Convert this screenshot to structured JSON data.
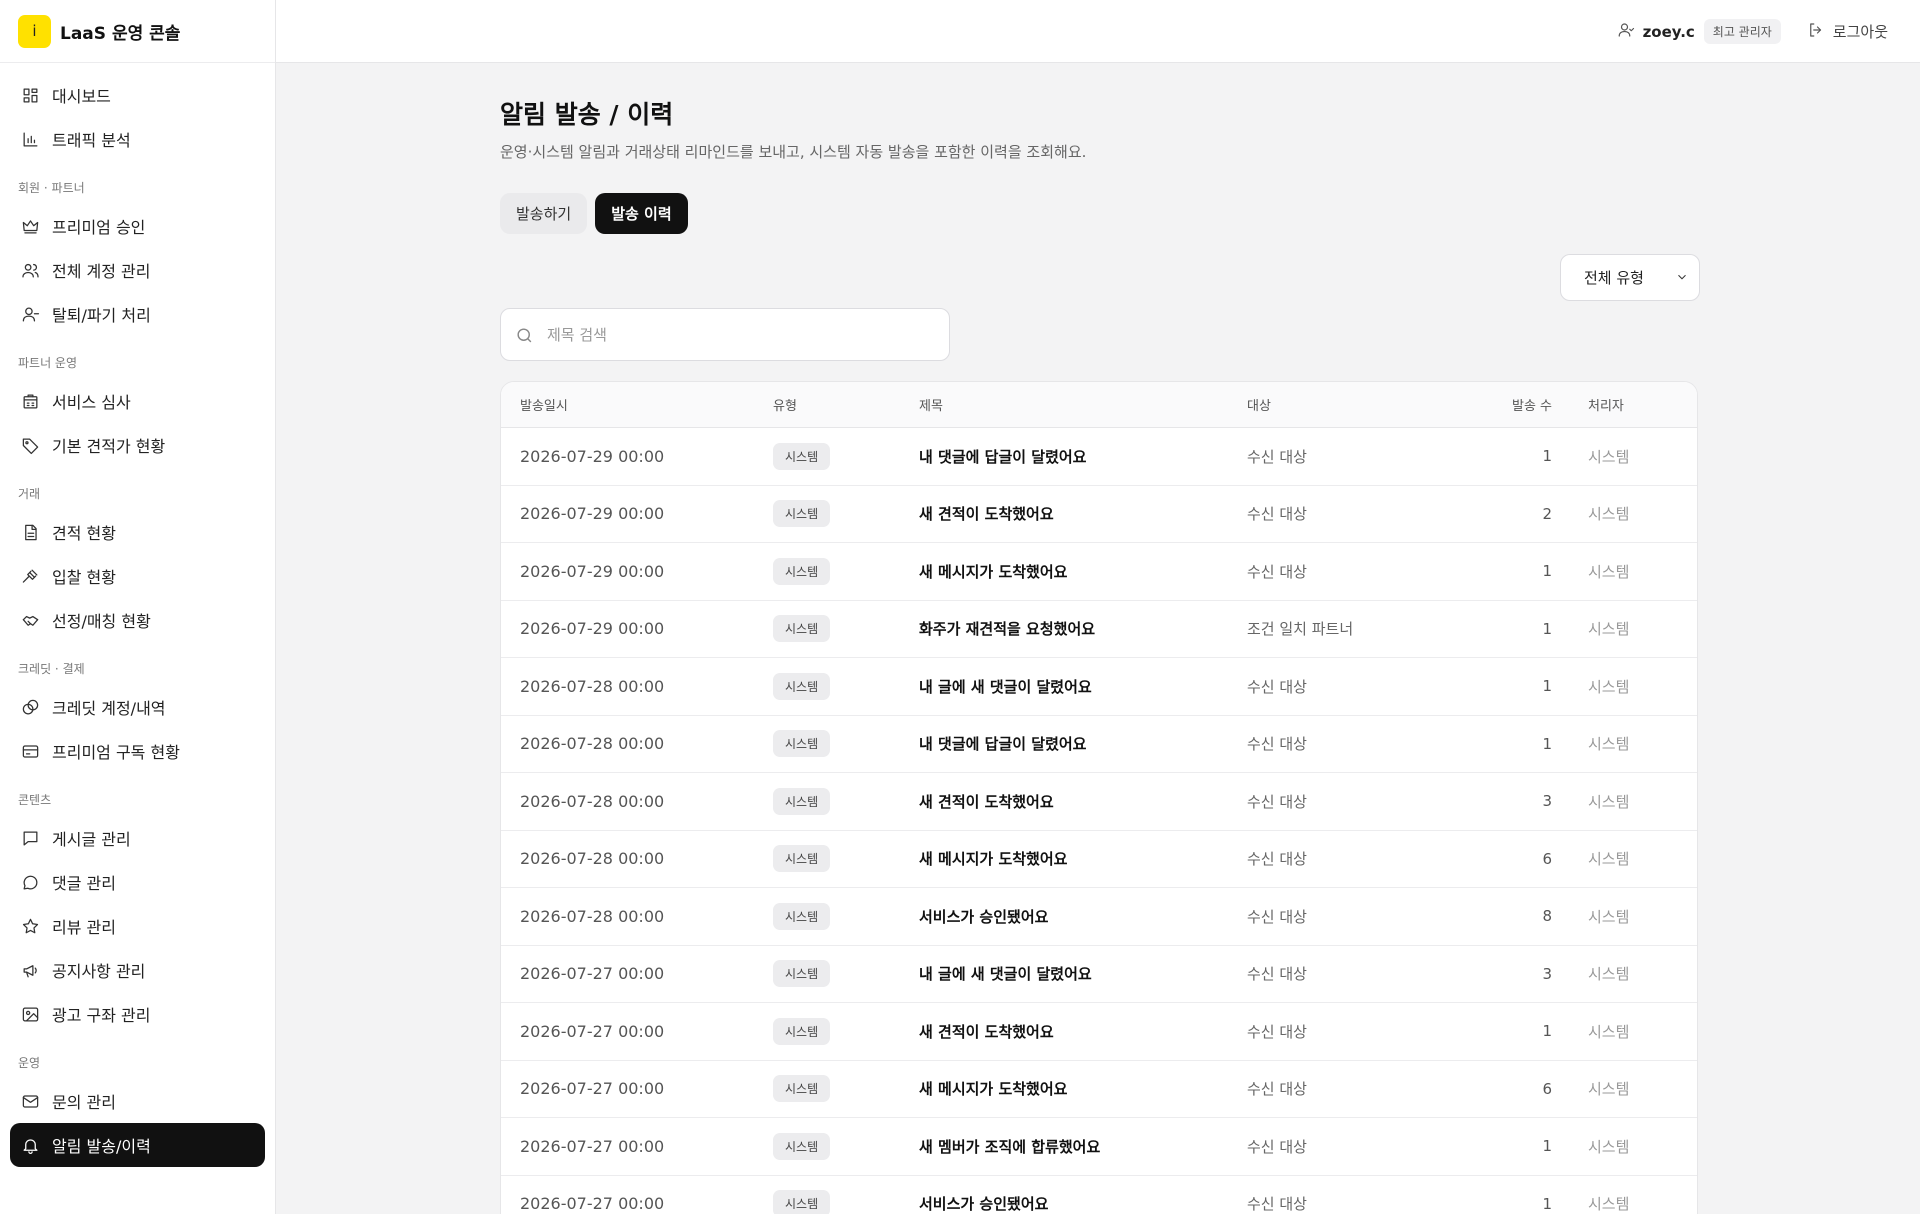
{
  "brand": {
    "logo_char": "i",
    "title": "LaaS 운영 콘솔",
    "accent": "#ffe100"
  },
  "header": {
    "user_name": "zoey.c",
    "role": "최고 관리자",
    "logout_label": "로그아웃"
  },
  "sidebar": {
    "top_items": [
      {
        "label": "대시보드",
        "icon": "dashboard-icon"
      },
      {
        "label": "트래픽 분석",
        "icon": "bar-chart-icon"
      }
    ],
    "groups": [
      {
        "title": "회원 · 파트너",
        "items": [
          {
            "label": "프리미엄 승인",
            "icon": "crown-icon"
          },
          {
            "label": "전체 계정 관리",
            "icon": "users-icon"
          },
          {
            "label": "탈퇴/파기 처리",
            "icon": "user-minus-icon"
          }
        ]
      },
      {
        "title": "파트너 운영",
        "items": [
          {
            "label": "서비스 심사",
            "icon": "building-icon"
          },
          {
            "label": "기본 견적가 현황",
            "icon": "tag-icon"
          }
        ]
      },
      {
        "title": "거래",
        "items": [
          {
            "label": "견적 현황",
            "icon": "document-icon"
          },
          {
            "label": "입찰 현황",
            "icon": "gavel-icon"
          },
          {
            "label": "선정/매칭 현황",
            "icon": "handshake-icon"
          }
        ]
      },
      {
        "title": "크레딧 · 결제",
        "items": [
          {
            "label": "크레딧 계정/내역",
            "icon": "coins-icon"
          },
          {
            "label": "프리미엄 구독 현황",
            "icon": "credit-card-icon"
          }
        ]
      },
      {
        "title": "콘텐츠",
        "items": [
          {
            "label": "게시글 관리",
            "icon": "message-square-icon"
          },
          {
            "label": "댓글 관리",
            "icon": "message-circle-icon"
          },
          {
            "label": "리뷰 관리",
            "icon": "star-icon"
          },
          {
            "label": "공지사항 관리",
            "icon": "megaphone-icon"
          },
          {
            "label": "광고 구좌 관리",
            "icon": "image-icon"
          }
        ]
      },
      {
        "title": "운영",
        "items": [
          {
            "label": "문의 관리",
            "icon": "mail-icon"
          },
          {
            "label": "알림 발송/이력",
            "icon": "bell-icon",
            "active": true
          }
        ]
      }
    ]
  },
  "page": {
    "title": "알림 발송 / 이력",
    "description": "운영·시스템 알림과 거래상태 리마인드를 보내고, 시스템 자동 발송을 포함한 이력을 조회해요.",
    "tabs": [
      {
        "label": "발송하기",
        "active": false
      },
      {
        "label": "발송 이력",
        "active": true
      }
    ],
    "type_filter": "전체 유형",
    "search_placeholder": "제목 검색"
  },
  "table": {
    "columns": {
      "date": "발송일시",
      "type": "유형",
      "title": "제목",
      "target": "대상",
      "count": "발송 수",
      "handler": "처리자"
    },
    "rows": [
      {
        "date": "2026-07-29 00:00",
        "type": "시스템",
        "title": "내 댓글에 답글이 달렸어요",
        "target": "수신 대상",
        "count": "1",
        "handler": "시스템"
      },
      {
        "date": "2026-07-29 00:00",
        "type": "시스템",
        "title": "새 견적이 도착했어요",
        "target": "수신 대상",
        "count": "2",
        "handler": "시스템"
      },
      {
        "date": "2026-07-29 00:00",
        "type": "시스템",
        "title": "새 메시지가 도착했어요",
        "target": "수신 대상",
        "count": "1",
        "handler": "시스템"
      },
      {
        "date": "2026-07-29 00:00",
        "type": "시스템",
        "title": "화주가 재견적을 요청했어요",
        "target": "조건 일치 파트너",
        "count": "1",
        "handler": "시스템"
      },
      {
        "date": "2026-07-28 00:00",
        "type": "시스템",
        "title": "내 글에 새 댓글이 달렸어요",
        "target": "수신 대상",
        "count": "1",
        "handler": "시스템"
      },
      {
        "date": "2026-07-28 00:00",
        "type": "시스템",
        "title": "내 댓글에 답글이 달렸어요",
        "target": "수신 대상",
        "count": "1",
        "handler": "시스템"
      },
      {
        "date": "2026-07-28 00:00",
        "type": "시스템",
        "title": "새 견적이 도착했어요",
        "target": "수신 대상",
        "count": "3",
        "handler": "시스템"
      },
      {
        "date": "2026-07-28 00:00",
        "type": "시스템",
        "title": "새 메시지가 도착했어요",
        "target": "수신 대상",
        "count": "6",
        "handler": "시스템"
      },
      {
        "date": "2026-07-28 00:00",
        "type": "시스템",
        "title": "서비스가 승인됐어요",
        "target": "수신 대상",
        "count": "8",
        "handler": "시스템"
      },
      {
        "date": "2026-07-27 00:00",
        "type": "시스템",
        "title": "내 글에 새 댓글이 달렸어요",
        "target": "수신 대상",
        "count": "3",
        "handler": "시스템"
      },
      {
        "date": "2026-07-27 00:00",
        "type": "시스템",
        "title": "새 견적이 도착했어요",
        "target": "수신 대상",
        "count": "1",
        "handler": "시스템"
      },
      {
        "date": "2026-07-27 00:00",
        "type": "시스템",
        "title": "새 메시지가 도착했어요",
        "target": "수신 대상",
        "count": "6",
        "handler": "시스템"
      },
      {
        "date": "2026-07-27 00:00",
        "type": "시스템",
        "title": "새 멤버가 조직에 합류했어요",
        "target": "수신 대상",
        "count": "1",
        "handler": "시스템"
      },
      {
        "date": "2026-07-27 00:00",
        "type": "시스템",
        "title": "서비스가 승인됐어요",
        "target": "수신 대상",
        "count": "1",
        "handler": "시스템"
      }
    ]
  }
}
